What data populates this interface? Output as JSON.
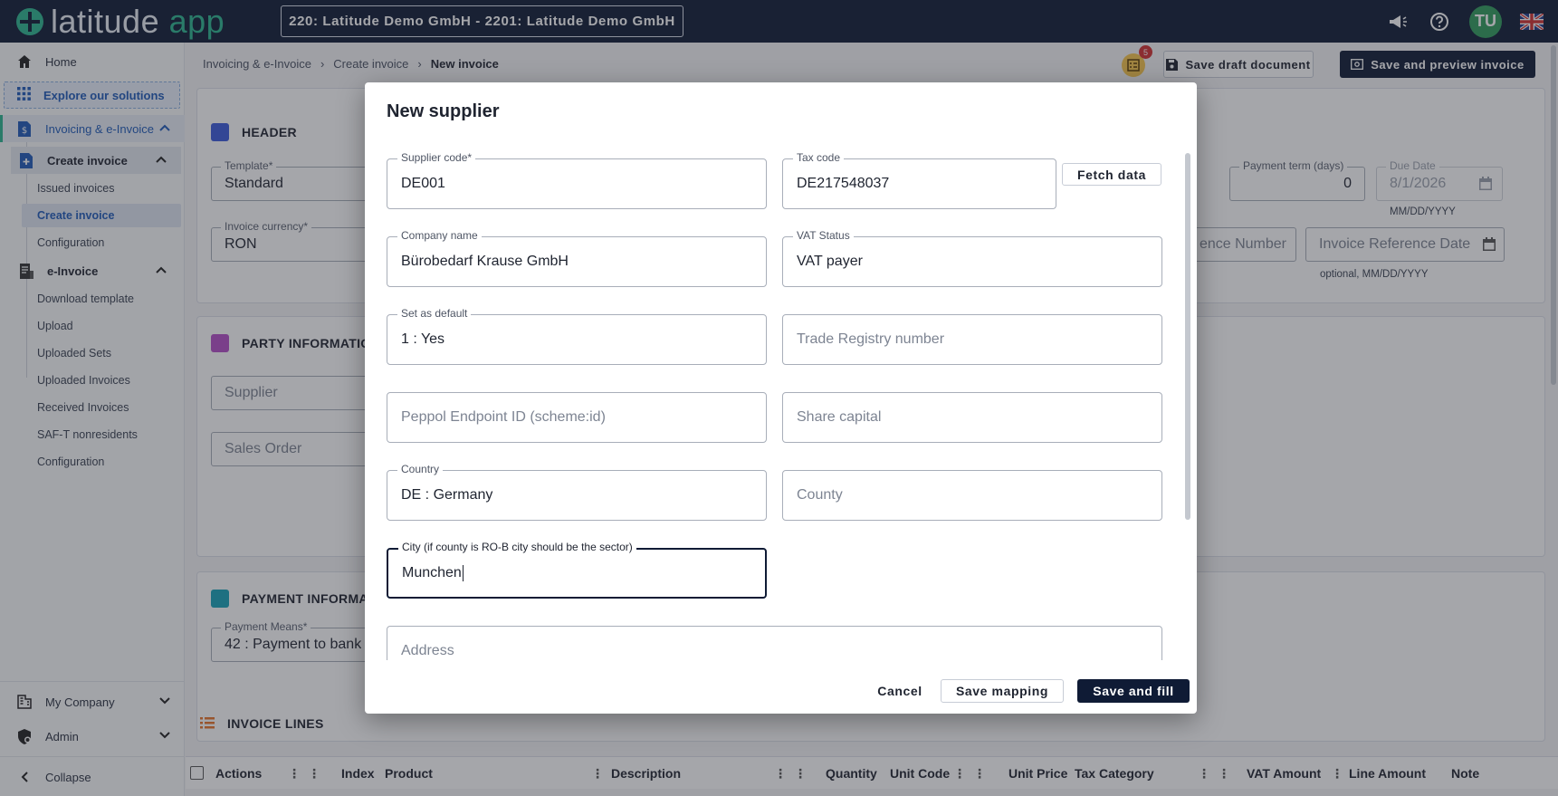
{
  "app": {
    "logo_word": "latitude",
    "logo_app": "app",
    "company_selector": "220: Latitude Demo GmbH - 2201: Latitude Demo GmbH",
    "avatar_initials": "TU",
    "notification_count": "5"
  },
  "sidebar": {
    "home": "Home",
    "explore": "Explore our solutions",
    "invoicing": "Invoicing & e-Invoice",
    "create_invoice_group": "Create invoice",
    "issued_invoices": "Issued invoices",
    "create_invoice": "Create invoice",
    "configuration_1": "Configuration",
    "einvoice": "e-Invoice",
    "download_template": "Download template",
    "upload": "Upload",
    "uploaded_sets": "Uploaded Sets",
    "uploaded_invoices": "Uploaded Invoices",
    "received_invoices": "Received Invoices",
    "saft": "SAF-T nonresidents",
    "configuration_2": "Configuration",
    "my_company": "My Company",
    "admin": "Admin",
    "collapse": "Collapse"
  },
  "breadcrumb": {
    "level1": "Invoicing & e-Invoice",
    "level2": "Create invoice",
    "current": "New invoice"
  },
  "actions": {
    "save_draft": "Save draft document",
    "save_preview": "Save and preview invoice"
  },
  "header_section": {
    "title": "HEADER",
    "template_label": "Template*",
    "template_value": "Standard",
    "currency_label": "Invoice currency*",
    "currency_value": "RON",
    "payment_term_label": "Payment term (days)",
    "payment_term_value": "0",
    "due_date_label": "Due Date",
    "due_date_value": "8/1/2026",
    "due_date_hint": "MM/DD/YYYY",
    "ref_number_partial": "ence Number",
    "ref_date_placeholder": "Invoice Reference Date",
    "ref_date_hint": "optional, MM/DD/YYYY"
  },
  "party_section": {
    "title": "PARTY INFORMATIO",
    "supplier_placeholder": "Supplier",
    "sales_order_placeholder": "Sales Order"
  },
  "payment_section": {
    "title": "PAYMENT INFORMATI",
    "means_label": "Payment Means*",
    "means_value": "42 : Payment to bank"
  },
  "lines_section": {
    "title": "INVOICE LINES",
    "columns": [
      "Actions",
      "Index",
      "Product",
      "Description",
      "Quantity",
      "Unit Code",
      "Unit Price",
      "Tax Category",
      "VAT Amount",
      "Line Amount",
      "Note"
    ]
  },
  "modal": {
    "title": "New supplier",
    "fetch_data": "Fetch data",
    "fields": {
      "supplier_code": {
        "label": "Supplier code*",
        "value": "DE001"
      },
      "tax_code": {
        "label": "Tax code",
        "value": "DE217548037"
      },
      "company_name": {
        "label": "Company name",
        "value": "Bürobedarf Krause GmbH"
      },
      "vat_status": {
        "label": "VAT Status",
        "value": "VAT payer"
      },
      "set_default": {
        "label": "Set as default",
        "value": "1 : Yes"
      },
      "trade_registry": {
        "placeholder": "Trade Registry number"
      },
      "peppol": {
        "placeholder": "Peppol Endpoint ID (scheme:id)"
      },
      "share_capital": {
        "placeholder": "Share capital"
      },
      "country": {
        "label": "Country",
        "value": "DE : Germany"
      },
      "county": {
        "placeholder": "County"
      },
      "city": {
        "label": "City (if county is RO-B city should be the sector)",
        "value": "Munchen"
      },
      "address": {
        "placeholder": "Address"
      }
    },
    "buttons": {
      "cancel": "Cancel",
      "save_mapping": "Save mapping",
      "save_fill": "Save and fill"
    }
  }
}
